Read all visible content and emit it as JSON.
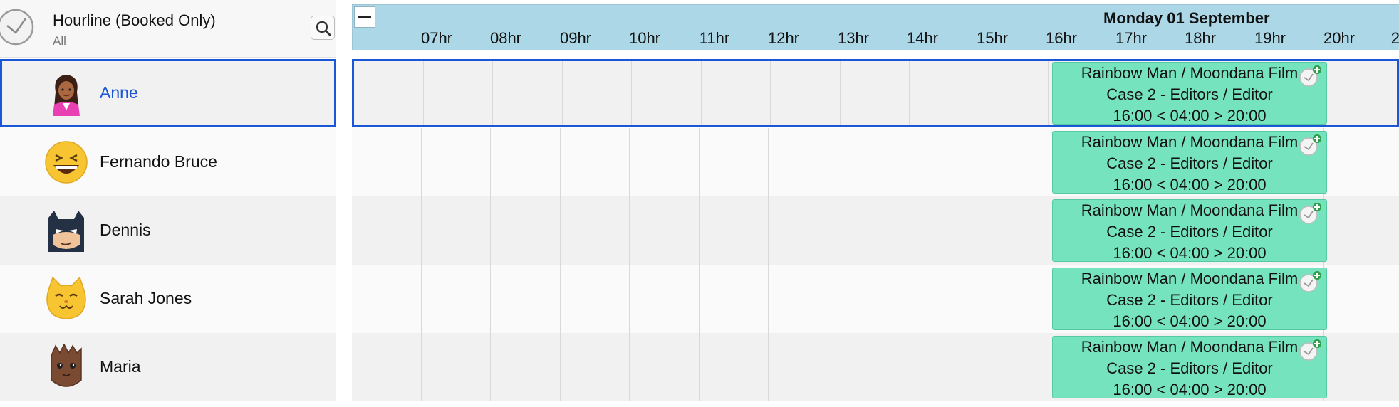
{
  "header": {
    "title": "Hourline (Booked Only)",
    "filter": "All",
    "date": "Monday 01 September"
  },
  "hours": [
    "07hr",
    "08hr",
    "09hr",
    "10hr",
    "11hr",
    "12hr",
    "13hr",
    "14hr",
    "15hr",
    "16hr",
    "17hr",
    "18hr",
    "19hr",
    "20hr",
    "2"
  ],
  "people": [
    {
      "name": "Anne",
      "avatar": "woman-avatar-icon",
      "selected": true
    },
    {
      "name": "Fernando Bruce",
      "avatar": "grinning-face-avatar-icon",
      "selected": false
    },
    {
      "name": "Dennis",
      "avatar": "bat-mask-avatar-icon",
      "selected": false
    },
    {
      "name": "Sarah Jones",
      "avatar": "cat-face-avatar-icon",
      "selected": false
    },
    {
      "name": "Maria",
      "avatar": "tree-creature-avatar-icon",
      "selected": false
    }
  ],
  "bookings": [
    {
      "line1": "Rainbow Man / Moondana Film",
      "line2": "Case 2 - Editors / Editor",
      "line3": "16:00 < 04:00 > 20:00"
    },
    {
      "line1": "Rainbow Man / Moondana Film",
      "line2": "Case 2 - Editors / Editor",
      "line3": "16:00 < 04:00 > 20:00"
    },
    {
      "line1": "Rainbow Man / Moondana Film",
      "line2": "Case 2 - Editors / Editor",
      "line3": "16:00 < 04:00 > 20:00"
    },
    {
      "line1": "Rainbow Man / Moondana Film",
      "line2": "Case 2 - Editors / Editor",
      "line3": "16:00 < 04:00 > 20:00"
    },
    {
      "line1": "Rainbow Man / Moondana Film",
      "line2": "Case 2 - Editors / Editor",
      "line3": "16:00 < 04:00 > 20:00"
    }
  ],
  "colors": {
    "timeline_header": "#acd7e6",
    "booking": "#76e3bf",
    "selection": "#1a56d6"
  }
}
